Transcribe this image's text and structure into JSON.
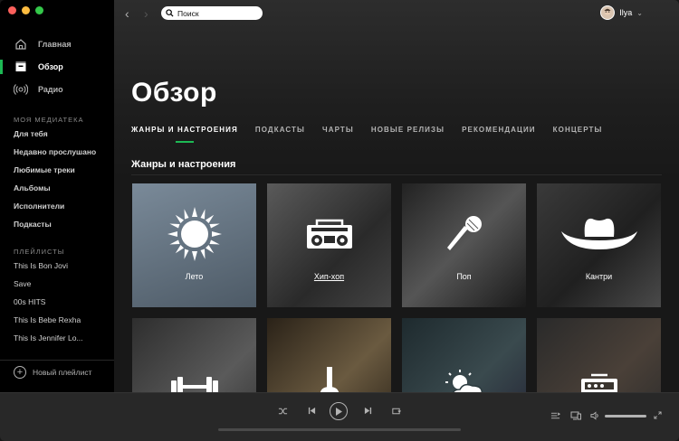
{
  "sidebar": {
    "nav": [
      {
        "label": "Главная",
        "icon": "home-icon"
      },
      {
        "label": "Обзор",
        "icon": "browse-icon"
      },
      {
        "label": "Радио",
        "icon": "radio-icon"
      }
    ],
    "library_label": "МОЯ МЕДИАТЕКА",
    "library": [
      "Для тебя",
      "Недавно прослушано",
      "Любимые треки",
      "Альбомы",
      "Исполнители",
      "Подкасты"
    ],
    "playlists_label": "ПЛЕЙЛИСТЫ",
    "playlists": [
      "This Is Bon Jovi",
      "Save",
      "00s HITS",
      "This Is Bebe Rexha",
      "This Is Jennifer Lo..."
    ],
    "new_playlist": "Новый плейлист"
  },
  "topbar": {
    "search_placeholder": "Поиск",
    "user_name": "Ilya"
  },
  "main": {
    "title": "Обзор",
    "tabs": [
      "ЖАНРЫ И НАСТРОЕНИЯ",
      "ПОДКАСТЫ",
      "ЧАРТЫ",
      "НОВЫЕ РЕЛИЗЫ",
      "РЕКОМЕНДАЦИИ",
      "КОНЦЕРТЫ"
    ],
    "section_title": "Жанры и настроения",
    "tiles": [
      {
        "label": "Лето",
        "icon": "sun-icon"
      },
      {
        "label": "Хип-хоп",
        "icon": "boombox-icon"
      },
      {
        "label": "Поп",
        "icon": "microphone-icon"
      },
      {
        "label": "Кантри",
        "icon": "cowboy-hat-icon"
      },
      {
        "label": "",
        "icon": "dumbbell-icon"
      },
      {
        "label": "",
        "icon": "acoustic-guitar-icon"
      },
      {
        "label": "",
        "icon": "weather-icon"
      },
      {
        "label": "",
        "icon": "amplifier-icon"
      }
    ]
  },
  "colors": {
    "accent": "#1db954",
    "sidebar_bg": "#000000",
    "player_bg": "#282828"
  }
}
